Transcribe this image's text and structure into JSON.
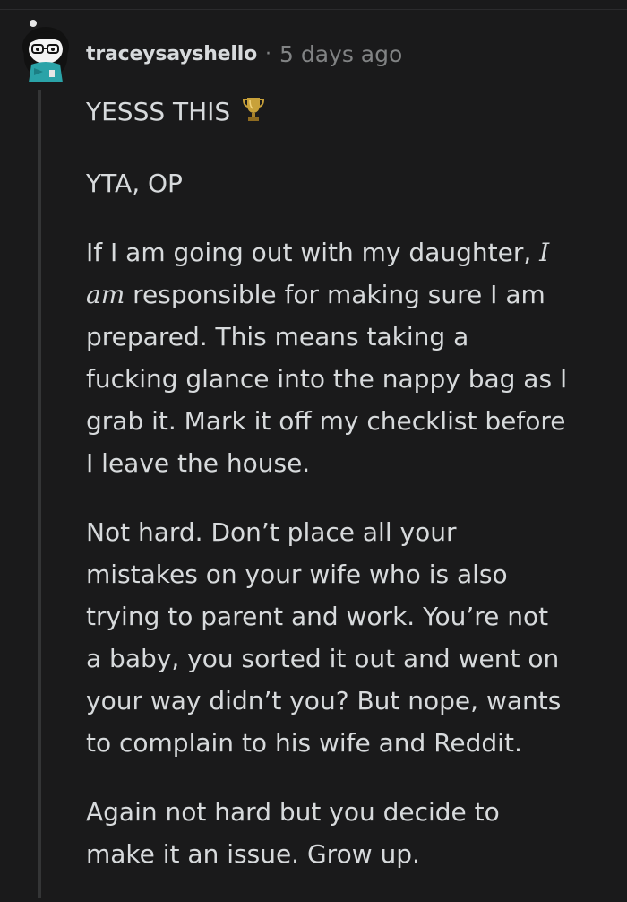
{
  "comment": {
    "username": "traceysayshello",
    "separator": "·",
    "timestamp": "5 days ago",
    "avatar_icon": "snoo-avatar-glasses",
    "trophy_icon": "trophy-icon",
    "paragraphs": {
      "p1": "YESSS THIS",
      "p2": "YTA, OP",
      "p3_lines": [
        "If I am going out with my daughter,",
        "I",
        "am",
        " responsible for making sure I am",
        "prepared. This means taking a",
        "fucking glance into the nappy bag as I",
        "grab it. Mark it off my checklist before",
        "I leave the house."
      ],
      "p4_lines": [
        "Not hard. Don’t place all your",
        "mistakes on your wife who is also",
        "trying to parent and work. You’re not",
        "a baby, you sorted it out and went on",
        "your way didn’t you? But nope, wants",
        "to complain to his wife and Reddit."
      ],
      "p5_lines": [
        "Again not hard but you decide to",
        "make it an issue. Grow up."
      ]
    }
  },
  "colors": {
    "background": "#1a1a1b",
    "text": "#d7dadc",
    "meta": "#818384",
    "thread_line": "#343536",
    "trophy": "#c8a13a"
  }
}
